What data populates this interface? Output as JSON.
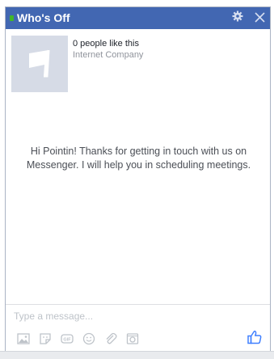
{
  "header": {
    "title": "Who's Off",
    "settings_icon": "gear-icon",
    "close_icon": "close-icon"
  },
  "page_info": {
    "likes": "0 people like this",
    "category": "Internet Company"
  },
  "greeting": "Hi Pointin! Thanks for getting in touch with us on Messenger. I will help you in scheduling meetings.",
  "composer": {
    "placeholder": "Type a message...",
    "tools": [
      "photo-icon",
      "sticker-icon",
      "gif-icon",
      "emoji-icon",
      "attachment-icon",
      "camera-icon"
    ],
    "like_icon": "thumbs-up-icon"
  },
  "colors": {
    "header": "#4267b2",
    "online": "#42b72a",
    "accent": "#4080ff"
  }
}
